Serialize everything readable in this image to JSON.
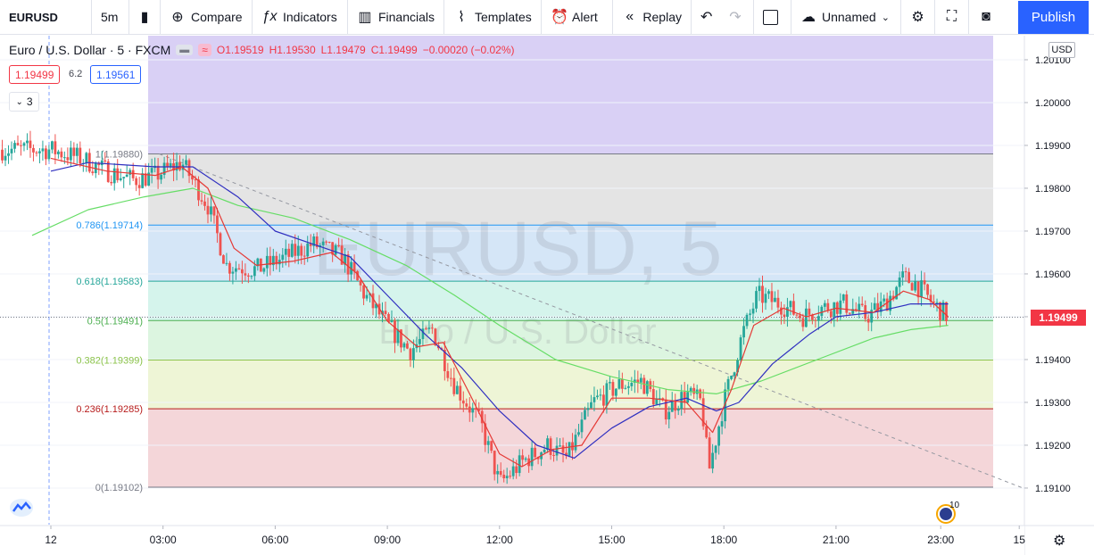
{
  "toolbar": {
    "symbol": "EURUSD",
    "interval": "5m",
    "compare": "Compare",
    "indicators": "Indicators",
    "financials": "Financials",
    "templates": "Templates",
    "alert": "Alert",
    "replay": "Replay",
    "layout_name": "Unnamed",
    "publish": "Publish"
  },
  "legend": {
    "title": "Euro / U.S. Dollar · 5 · FXCM",
    "open": "O1.19519",
    "high": "H1.19530",
    "low": "L1.19479",
    "close": "C1.19499",
    "change": "−0.00020 (−0.02%)"
  },
  "sell_price": "1.19499",
  "spread": "6.2",
  "buy_price": "1.19561",
  "indicators_count": "3",
  "currency": "USD",
  "last_price": "1.19499",
  "watermark": {
    "symbol": "EURUSD, 5",
    "name": "Euro / U.S. Dollar"
  },
  "badge_count": "10",
  "colors": {
    "up": "#26a69a",
    "down": "#ef5350",
    "ema_fast": "#e53935",
    "ema_slow": "#3030c0",
    "ma_long": "#66dd66",
    "fib_top": "#d9d0f5",
    "fib_1": "#e4e4e4",
    "fib_786": "#d5e6f7",
    "fib_618": "#d5f4ec",
    "fib_5": "#dcf5e0",
    "fib_382": "#eef5d6",
    "fib_236": "#f4d6d9"
  },
  "chart_data": {
    "type": "candlestick",
    "x_ticks": [
      "12",
      "03:00",
      "06:00",
      "09:00",
      "12:00",
      "15:00",
      "18:00",
      "21:00",
      "23:00",
      "15"
    ],
    "y_ticks": [
      "1.20100",
      "1.20000",
      "1.19900",
      "1.19800",
      "1.19700",
      "1.19600",
      "1.19500",
      "1.19400",
      "1.19300",
      "1.19200",
      "1.19100"
    ],
    "ylim": [
      1.1901,
      1.2014
    ],
    "fib_levels": [
      {
        "label": "1(1.19880)",
        "value": 1.1988,
        "color": "#787b86"
      },
      {
        "label": "0.786(1.19714)",
        "value": 1.19714,
        "color": "#2196f3"
      },
      {
        "label": "0.618(1.19583)",
        "value": 1.19583,
        "color": "#26a69a"
      },
      {
        "label": "0.5(1.19491)",
        "value": 1.19491,
        "color": "#4caf50"
      },
      {
        "label": "0.382(1.19399)",
        "value": 1.19399,
        "color": "#8bc34a"
      },
      {
        "label": "0.236(1.19285)",
        "value": 1.19285,
        "color": "#b71c1c"
      },
      {
        "label": "0(1.19102)",
        "value": 1.19102,
        "color": "#787b86"
      }
    ],
    "price_path_hours": [
      [
        0.0,
        1.1989
      ],
      [
        0.8,
        1.1987
      ],
      [
        1.5,
        1.1984
      ],
      [
        2.2,
        1.1982
      ],
      [
        2.8,
        1.1983
      ],
      [
        3.5,
        1.1986
      ],
      [
        4.2,
        1.1976
      ],
      [
        4.7,
        1.1962
      ],
      [
        5.5,
        1.1961
      ],
      [
        6.3,
        1.1964
      ],
      [
        7.0,
        1.1967
      ],
      [
        7.8,
        1.1964
      ],
      [
        8.4,
        1.1955
      ],
      [
        9.0,
        1.1948
      ],
      [
        9.6,
        1.1942
      ],
      [
        10.2,
        1.1947
      ],
      [
        10.8,
        1.1934
      ],
      [
        11.5,
        1.1925
      ],
      [
        12.0,
        1.1911
      ],
      [
        12.6,
        1.1916
      ],
      [
        13.3,
        1.192
      ],
      [
        13.8,
        1.1917
      ],
      [
        14.5,
        1.193
      ],
      [
        15.2,
        1.1934
      ],
      [
        15.8,
        1.1935
      ],
      [
        16.4,
        1.1928
      ],
      [
        17.0,
        1.1932
      ],
      [
        17.4,
        1.193
      ],
      [
        17.6,
        1.1914
      ],
      [
        18.0,
        1.193
      ],
      [
        18.5,
        1.1946
      ],
      [
        18.9,
        1.1955
      ],
      [
        19.5,
        1.1953
      ],
      [
        20.1,
        1.195
      ],
      [
        20.6,
        1.1952
      ],
      [
        21.2,
        1.1953
      ],
      [
        21.8,
        1.195
      ],
      [
        22.3,
        1.1953
      ],
      [
        22.8,
        1.1959
      ],
      [
        23.1,
        1.1958
      ],
      [
        23.6,
        1.1953
      ],
      [
        24.0,
        1.195
      ]
    ],
    "ema_fast_path": [
      [
        0.0,
        1.1987
      ],
      [
        1.5,
        1.1984
      ],
      [
        2.8,
        1.1983
      ],
      [
        3.5,
        1.1985
      ],
      [
        4.2,
        1.198
      ],
      [
        4.9,
        1.1966
      ],
      [
        5.5,
        1.1962
      ],
      [
        6.5,
        1.1963
      ],
      [
        7.5,
        1.1965
      ],
      [
        8.2,
        1.196
      ],
      [
        9.0,
        1.1949
      ],
      [
        9.8,
        1.1943
      ],
      [
        10.5,
        1.1944
      ],
      [
        11.2,
        1.1932
      ],
      [
        12.0,
        1.1918
      ],
      [
        12.6,
        1.1915
      ],
      [
        13.4,
        1.1919
      ],
      [
        14.2,
        1.192
      ],
      [
        15.0,
        1.1931
      ],
      [
        16.0,
        1.1931
      ],
      [
        17.0,
        1.193
      ],
      [
        17.7,
        1.1923
      ],
      [
        18.2,
        1.1933
      ],
      [
        18.8,
        1.1948
      ],
      [
        19.6,
        1.1952
      ],
      [
        20.2,
        1.195
      ],
      [
        21.0,
        1.1952
      ],
      [
        22.0,
        1.1951
      ],
      [
        22.8,
        1.1956
      ],
      [
        23.5,
        1.1954
      ],
      [
        24.0,
        1.195
      ]
    ],
    "ema_slow_path": [
      [
        0.0,
        1.1984
      ],
      [
        1.0,
        1.1986
      ],
      [
        2.8,
        1.1985
      ],
      [
        3.8,
        1.1985
      ],
      [
        5.0,
        1.1978
      ],
      [
        6.0,
        1.197
      ],
      [
        7.0,
        1.1967
      ],
      [
        8.0,
        1.1964
      ],
      [
        9.0,
        1.1955
      ],
      [
        10.0,
        1.1946
      ],
      [
        11.0,
        1.1938
      ],
      [
        12.0,
        1.1928
      ],
      [
        13.0,
        1.192
      ],
      [
        14.0,
        1.1917
      ],
      [
        15.0,
        1.1924
      ],
      [
        16.0,
        1.1929
      ],
      [
        17.0,
        1.1931
      ],
      [
        17.8,
        1.1928
      ],
      [
        18.4,
        1.193
      ],
      [
        19.3,
        1.1939
      ],
      [
        20.3,
        1.1946
      ],
      [
        21.0,
        1.195
      ],
      [
        22.0,
        1.1951
      ],
      [
        23.0,
        1.1953
      ],
      [
        24.0,
        1.1953
      ]
    ],
    "ma_long_path": [
      [
        -0.5,
        1.1969
      ],
      [
        1.0,
        1.1975
      ],
      [
        2.5,
        1.1978
      ],
      [
        3.8,
        1.198
      ],
      [
        5.0,
        1.1976
      ],
      [
        6.5,
        1.1973
      ],
      [
        8.0,
        1.1968
      ],
      [
        9.5,
        1.1962
      ],
      [
        10.8,
        1.1955
      ],
      [
        12.0,
        1.1948
      ],
      [
        13.5,
        1.194
      ],
      [
        15.0,
        1.1936
      ],
      [
        16.5,
        1.1933
      ],
      [
        17.8,
        1.1932
      ],
      [
        19.0,
        1.1935
      ],
      [
        20.5,
        1.194
      ],
      [
        22.0,
        1.1945
      ],
      [
        23.0,
        1.1947
      ],
      [
        24.0,
        1.1948
      ]
    ],
    "trendline": [
      [
        2.9,
        1.1988
      ],
      [
        26.0,
        1.191
      ]
    ]
  }
}
